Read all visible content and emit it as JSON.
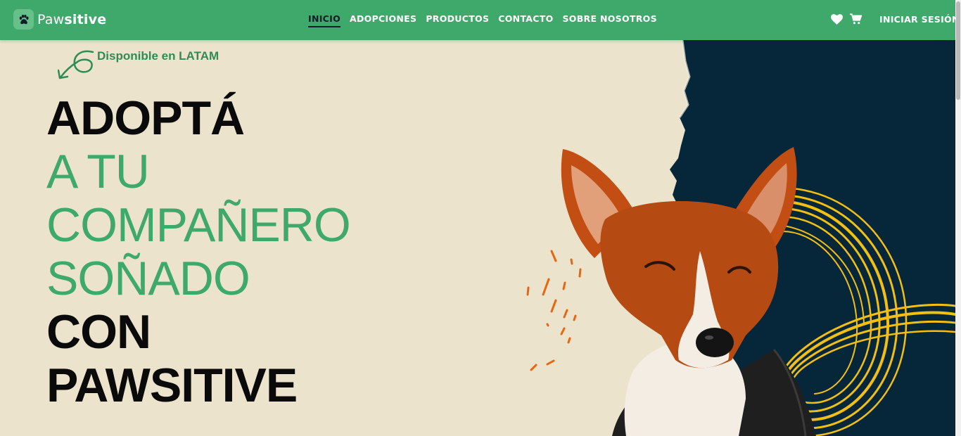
{
  "brand": {
    "name_light": "Paw",
    "name_bold": "sitive",
    "logo_icon": "paw-icon",
    "color_primary": "#3ea96a",
    "color_dark": "#0f1d2a",
    "color_cream": "#ece3cc",
    "color_navy": "#06273a",
    "color_yellow": "#f2bf12",
    "color_orange": "#e9660f"
  },
  "nav": {
    "links": [
      {
        "label": "INICIO",
        "active": true
      },
      {
        "label": "ADOPCIONES",
        "active": false
      },
      {
        "label": "PRODUCTOS",
        "active": false
      },
      {
        "label": "CONTACTO",
        "active": false
      },
      {
        "label": "SOBRE NOSOTROS",
        "active": false
      }
    ],
    "wishlist_icon": "heart-icon",
    "cart_icon": "cart-icon",
    "login_label": "INICIAR SESIÓN"
  },
  "hero": {
    "availability": "Disponible en LATAM",
    "availability_icon": "curved-arrow-icon",
    "headline": {
      "line1": "ADOPTÁ",
      "line2": "A TU",
      "line3": "COMPAÑERO",
      "line4": "SOÑADO",
      "line5": "CON",
      "line6": "PAWSITIVE"
    },
    "image": "basenji-dog-in-black-hoodie"
  }
}
